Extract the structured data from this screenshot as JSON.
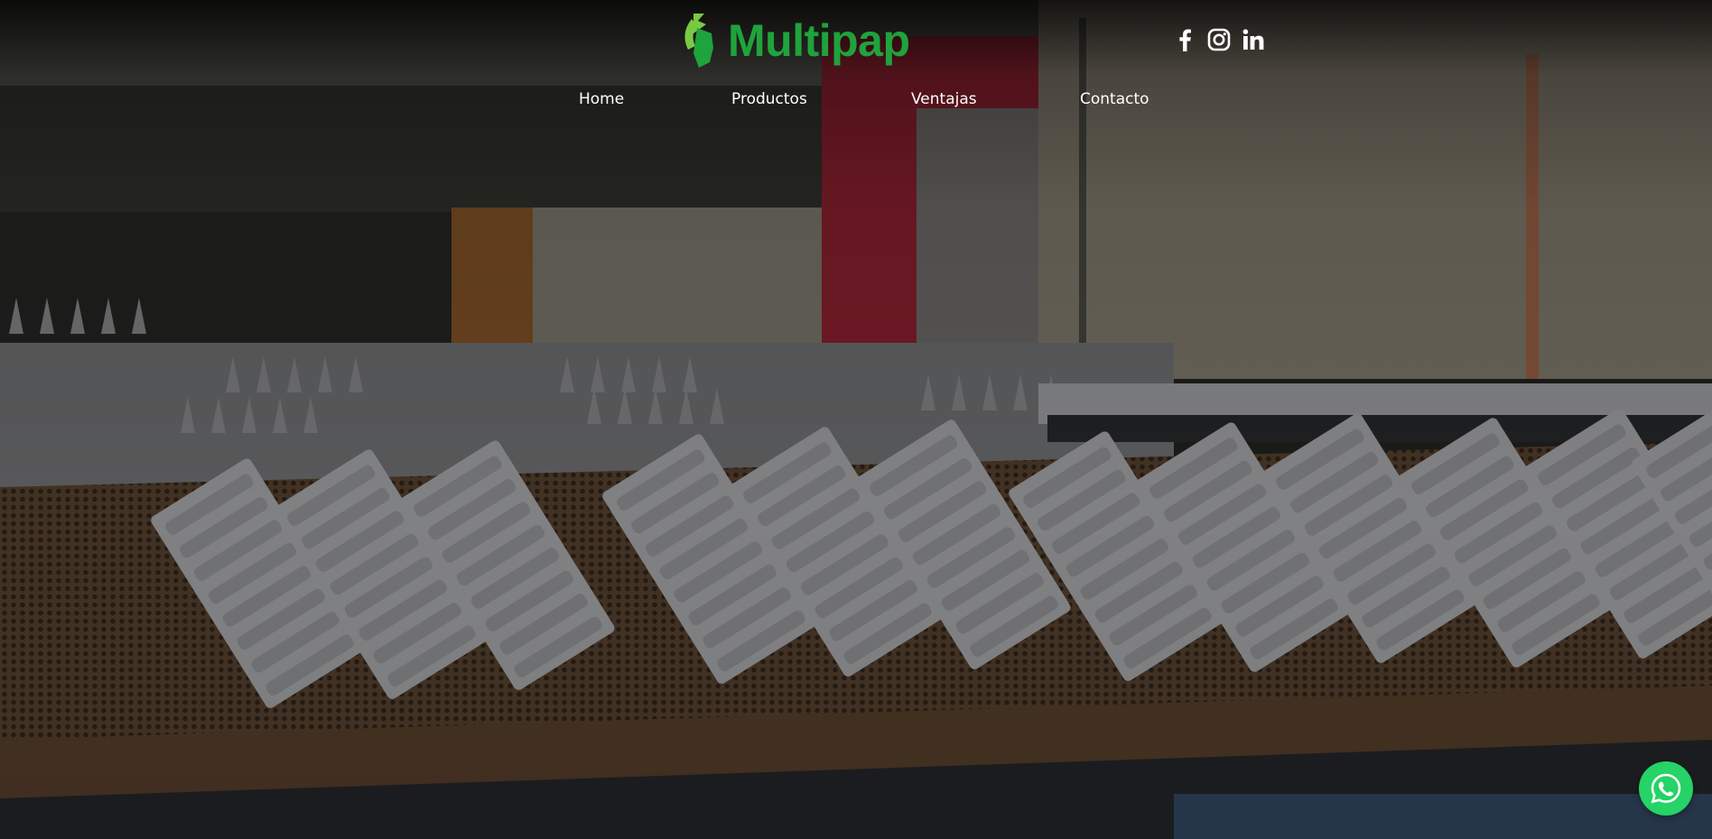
{
  "brand": {
    "name": "Multipap",
    "logo_icon": "leaf-arrow-logo-icon",
    "colors": {
      "green": "#1fa33c",
      "lime": "#7ac943"
    }
  },
  "social": {
    "items": [
      {
        "icon": "facebook-icon"
      },
      {
        "icon": "instagram-icon"
      },
      {
        "icon": "linkedin-icon"
      }
    ]
  },
  "nav": {
    "items": [
      {
        "label": "Home"
      },
      {
        "label": "Productos"
      },
      {
        "label": "Ventajas"
      },
      {
        "label": "Contacto"
      }
    ]
  },
  "hero": {
    "background_image": "egg-tray-production-conveyor-photo"
  },
  "whatsapp": {
    "icon": "whatsapp-icon",
    "color": "#25d366"
  }
}
